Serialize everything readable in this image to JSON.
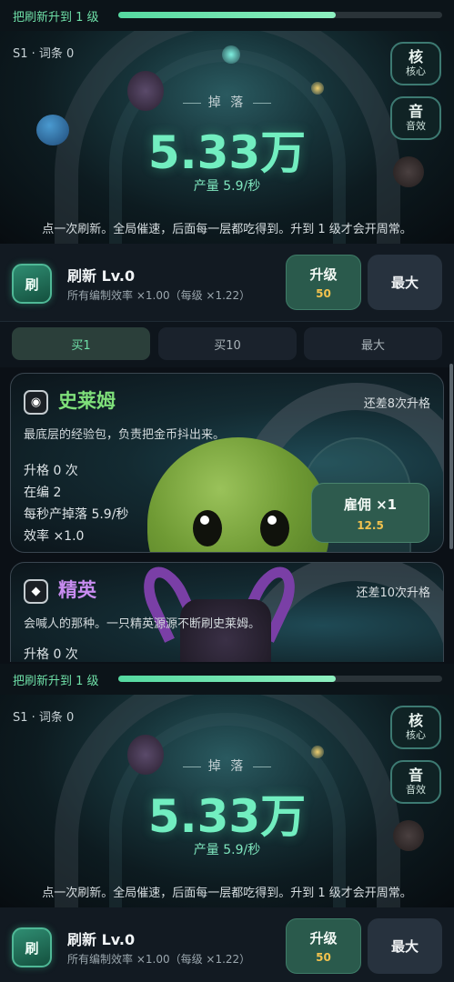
{
  "progress": {
    "label": "把刷新升到 1 级",
    "fraction": 0.67
  },
  "hero": {
    "meta": "S1 · 词条 0",
    "core_title": "核",
    "core_sub": "核心",
    "sound_title": "音",
    "sound_sub": "音效",
    "drop_label": "掉 落",
    "amount": "5.33万",
    "rate": "产量 5.9/秒",
    "tip": "点一次刷新。全局催速，后面每一层都吃得到。升到 1 级才会开周常。"
  },
  "refresh": {
    "icon_char": "刷",
    "title": "刷新 Lv.0",
    "subtitle": "所有编制效率 ×1.00（每级 ×1.22）",
    "upgrade_label": "升级",
    "upgrade_cost": "50",
    "max_label": "最大"
  },
  "buy_tabs": [
    {
      "label": "买1",
      "active": true
    },
    {
      "label": "买10",
      "active": false
    },
    {
      "label": "最大",
      "active": false
    }
  ],
  "units": [
    {
      "icon": "◉",
      "name": "史莱姆",
      "name_color": "#7fe07a",
      "need": "还差8次升格",
      "desc": "最底层的经验包，负责把金币抖出来。",
      "stats": [
        "升格 0 次",
        "在编 2",
        "每秒产掉落 5.9/秒",
        "效率 ×1.0"
      ],
      "hire_label": "雇佣 ×1",
      "hire_cost": "12.5"
    },
    {
      "icon": "◆",
      "name": "精英",
      "name_color": "#c88cf0",
      "need": "还差10次升格",
      "desc": "会喊人的那种。一只精英源源不断刷史莱姆。",
      "stats": [
        "升格 0 次"
      ]
    }
  ]
}
